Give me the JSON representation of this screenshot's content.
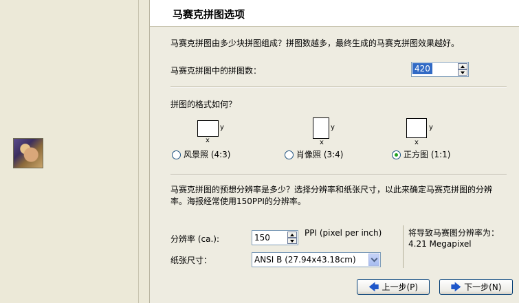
{
  "header": {
    "title": "马赛克拼图选项"
  },
  "intro_text": "马赛克拼图由多少块拼图组成？拼图数越多，最终生成的马赛克拼图效果越好。",
  "tiles": {
    "label": "马赛克拼图中的拼图数：",
    "value": "420"
  },
  "format": {
    "question": "拼图的格式如何？",
    "axis_x": "x",
    "axis_y": "y",
    "options": [
      {
        "label": "风景照 (4:3)",
        "selected": false
      },
      {
        "label": "肖像照 (3:4)",
        "selected": false
      },
      {
        "label": "正方图 (1:1)",
        "selected": true
      }
    ]
  },
  "resolution": {
    "description_line1": "马赛克拼图的预想分辨率是多少？选择分辨率和纸张尺寸，以此来确定马赛克拼图的分辨",
    "description_line2": "率。海报经常使用150PPI的分辨率。",
    "label": "分辨率 (ca.):",
    "value": "150",
    "unit": "PPI (pixel per inch)"
  },
  "paper": {
    "label": "纸张尺寸：",
    "value": "ANSI B (27.94x43.18cm)"
  },
  "result": {
    "line1": "将导致马赛图分辨率为：",
    "line2": "4.21 Megapixel"
  },
  "buttons": {
    "back": "上一步(P)",
    "next": "下一步(N)"
  },
  "icons": {
    "back": "arrow-left-icon",
    "next": "arrow-right-icon"
  },
  "colors": {
    "selection": "#316ac5",
    "radio_dot": "#21a121",
    "arrow": "#1f57c9"
  }
}
